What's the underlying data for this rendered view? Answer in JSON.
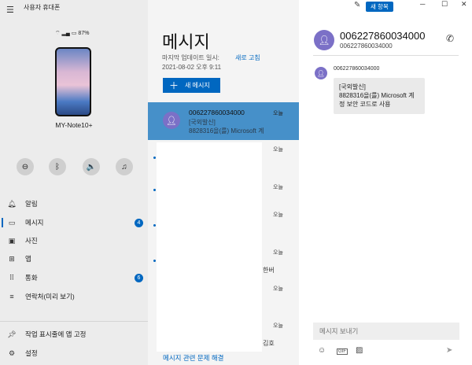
{
  "window": {
    "title": "사용자 휴대폰"
  },
  "top_buttons": {
    "new_version": "새 항목"
  },
  "phone": {
    "status": "87%",
    "name": "MY-Note10+"
  },
  "nav": [
    {
      "label": "알림",
      "icon": "bell-icon",
      "badge": ""
    },
    {
      "label": "메시지",
      "icon": "message-icon",
      "badge": "4"
    },
    {
      "label": "사진",
      "icon": "photo-icon",
      "badge": ""
    },
    {
      "label": "앱",
      "icon": "apps-icon",
      "badge": ""
    },
    {
      "label": "통화",
      "icon": "dialpad-icon",
      "badge": "6"
    },
    {
      "label": "연락처(미리 보기)",
      "icon": "contacts-icon",
      "badge": ""
    }
  ],
  "bottom_nav": {
    "pin": "작업 표시줄에 앱 고정",
    "settings": "설정"
  },
  "messages": {
    "title": "메시지",
    "sync_label": "마지막 업데이트 일시:",
    "sync_time": "2021-08-02 오후 9:11",
    "refresh": "새로 고침",
    "new_message": "새 메시지",
    "trouble": "메시지 관련 문제 해결",
    "conversations": [
      {
        "number": "006227860034000",
        "line1": "[국외발신]",
        "line2": "8828316을(를) Microsoft 계",
        "time": "오늘"
      }
    ],
    "other_times": [
      "오늘",
      "오늘",
      "오늘",
      "오늘",
      "오늘",
      "오늘"
    ],
    "side_text": [
      "한버",
      "김호"
    ]
  },
  "thread": {
    "name": "006227860034000",
    "number": "006227860034000",
    "sender": "006227860034000",
    "bubble": [
      "[국외발신]",
      "8828316을(를) Microsoft 계",
      "정 보안 코드로 사용"
    ],
    "input_placeholder": "메시지 보내기"
  }
}
